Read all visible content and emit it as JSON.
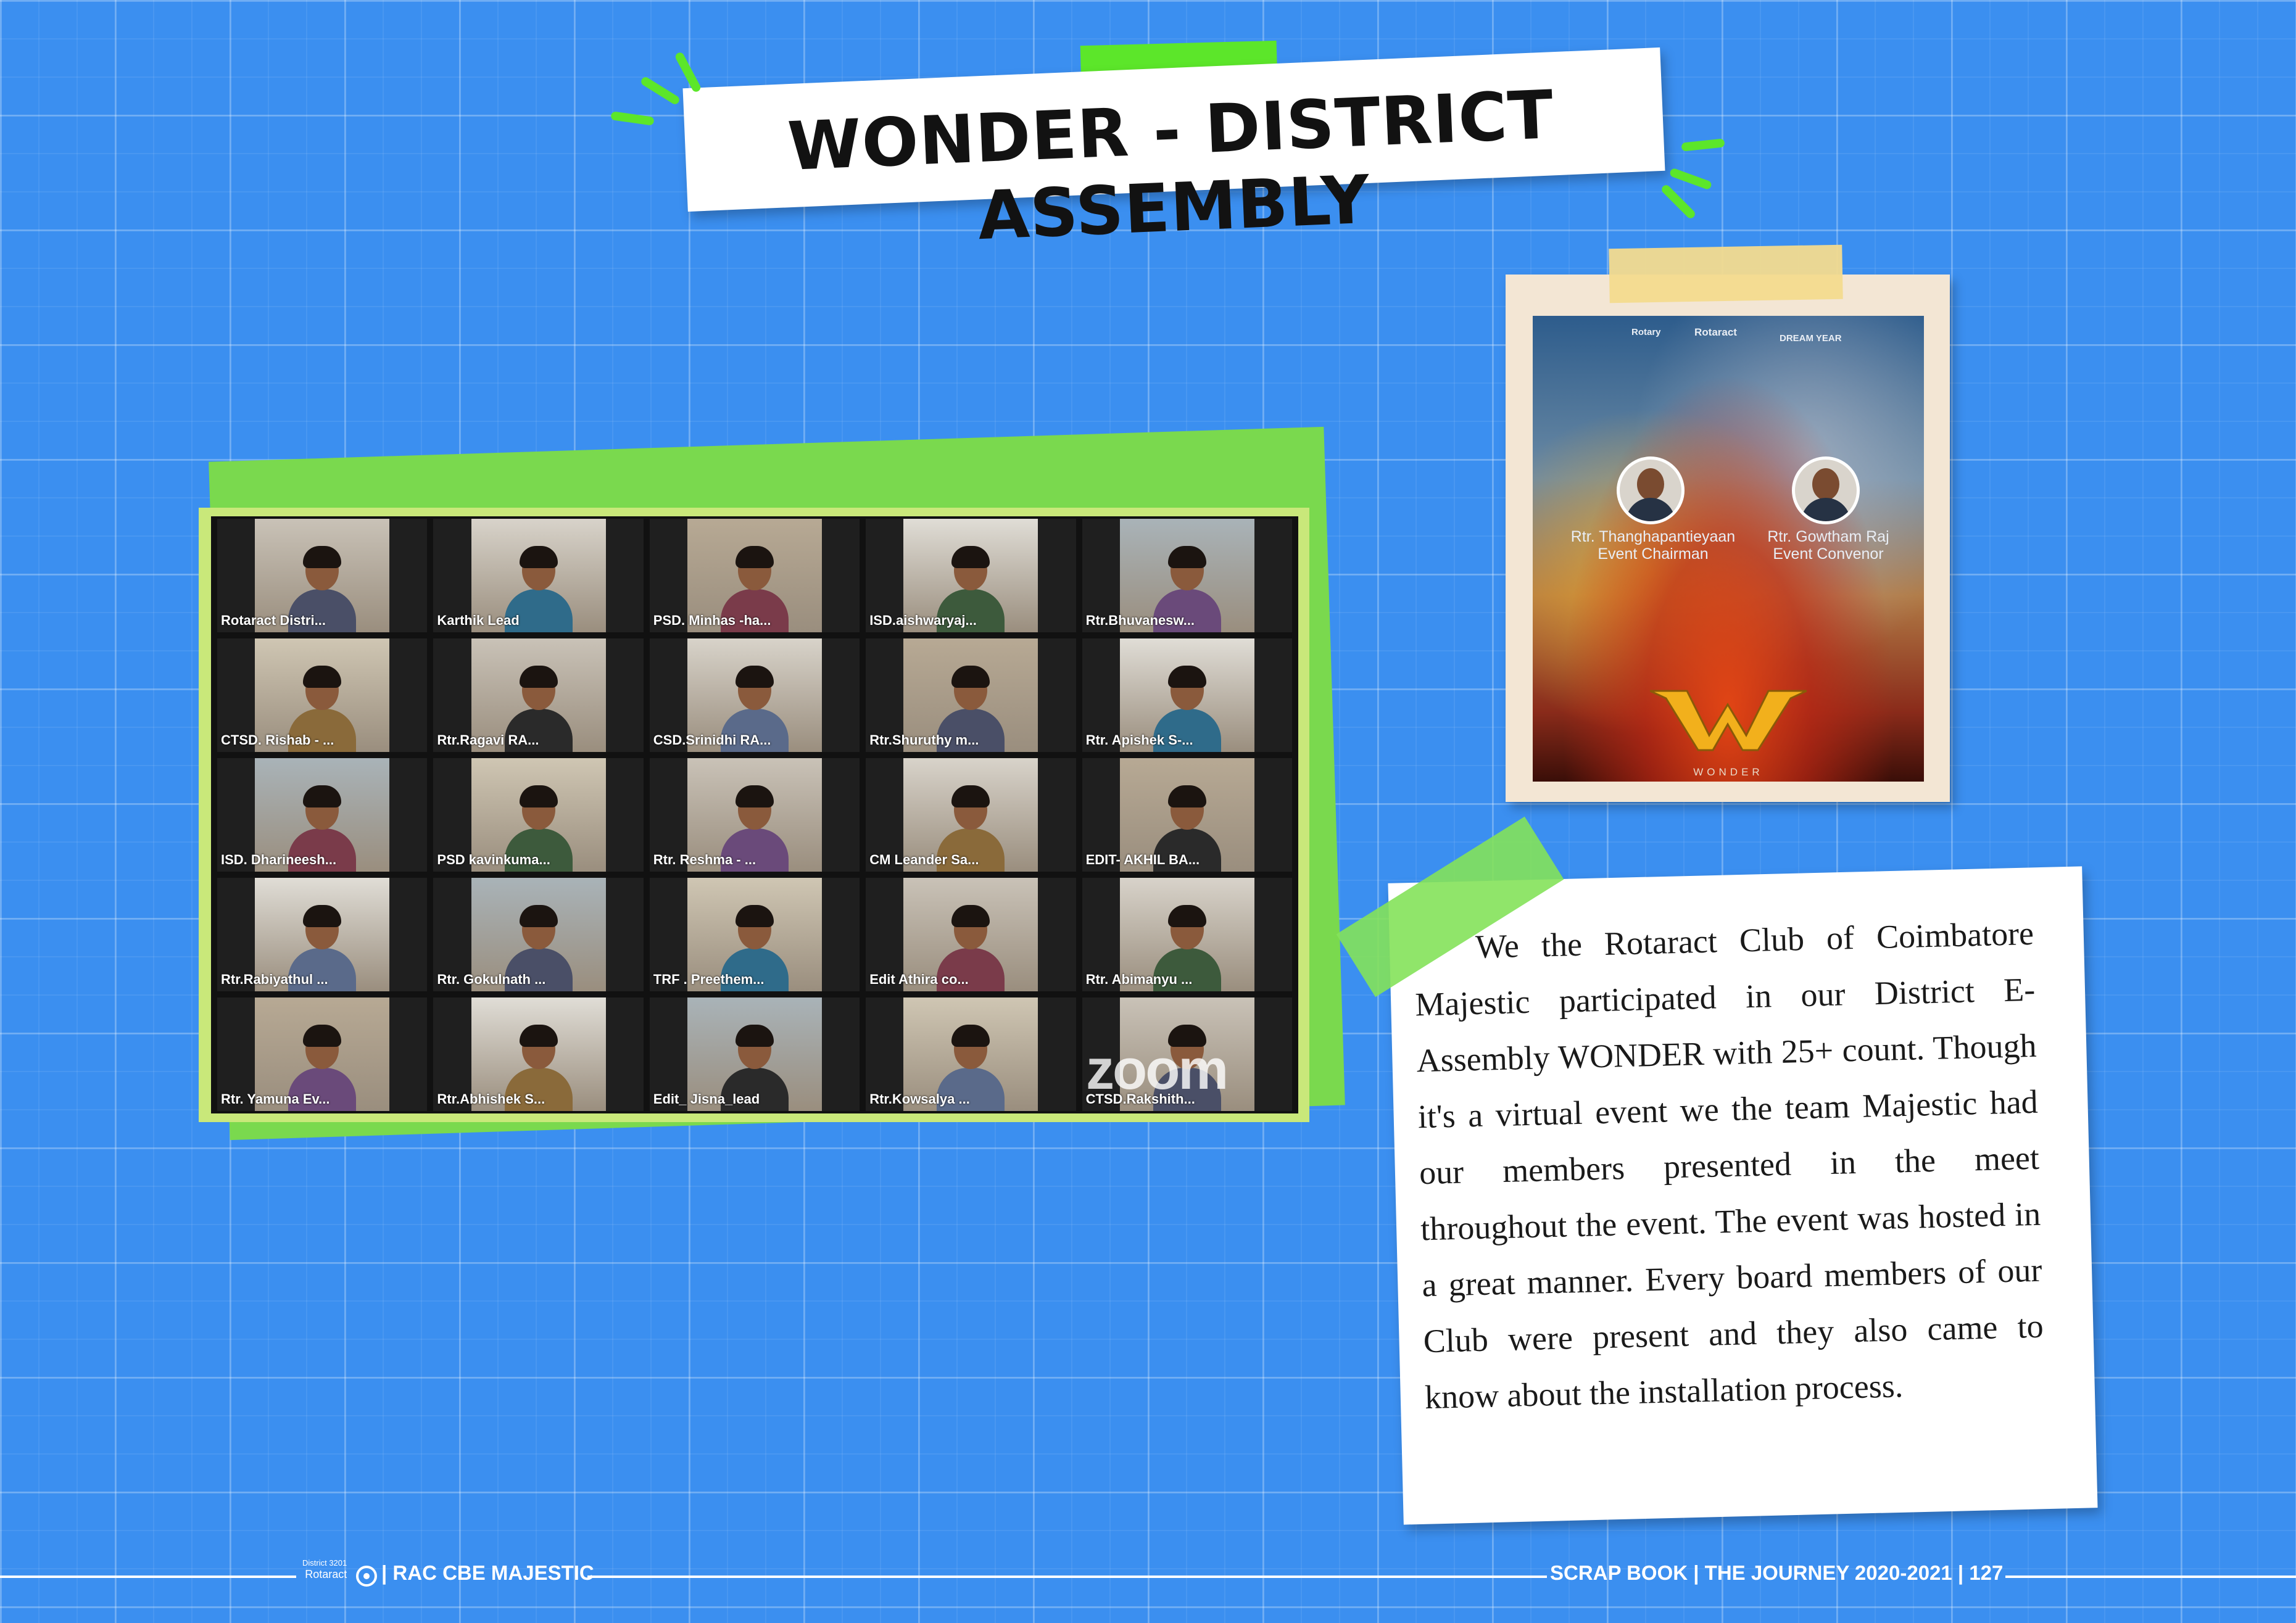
{
  "title": "WONDER - DISTRICT ASSEMBLY",
  "zoom": {
    "brand": "zoom",
    "participants": [
      "Rotaract Distri...",
      "Karthik Lead",
      "PSD. Minhas -ha...",
      "ISD.aishwaryaj...",
      "Rtr.Bhuvanesw...",
      "CTSD. Rishab - ...",
      "Rtr.Ragavi RA...",
      "CSD.Srinidhi RA...",
      "Rtr.Shuruthy m...",
      "Rtr. Apishek S-...",
      "ISD. Dharineesh...",
      "PSD kavinkuma...",
      "Rtr. Reshma - ...",
      "CM Leander Sa...",
      "EDIT- AKHIL BA...",
      "Rtr.Rabiyathul ...",
      "Rtr. Gokulnath ...",
      "TRF . Preethem...",
      "Edit Athira co...",
      "Rtr. Abimanyu ...",
      "Rtr. Yamuna Ev...",
      "Rtr.Abhishek S...",
      "Edit_ Jisna_lead",
      "Rtr.Kowsalya ...",
      "CTSD.Rakshith..."
    ]
  },
  "poster": {
    "logo_rotary": "Rotary",
    "logo_rotaract": "Rotaract",
    "logo_dream": "DREAM YEAR",
    "person1_name": "Rtr. Thanghapantieyaan",
    "person1_role": "Event Chairman",
    "person2_name": "Rtr. Gowtham Raj",
    "person2_role": "Event Convenor",
    "event": "WONDER"
  },
  "note": "We the Rotaract Club of Coimbatore Majestic participated in our District E-Assembly WONDER with 25+ count. Though it's a virtual event we the team Majestic had our members presented in the meet throughout the event. The event was hosted in a great manner. Every board members of our Club were present and they also came to know about the installation process.",
  "footer": {
    "logo_district": "District 3201",
    "logo_name": "Rotaract",
    "left": "| RAC CBE MAJESTIC",
    "right": "SCRAP BOOK | THE JOURNEY 2020-2021 | 127"
  },
  "colors": {
    "background": "#3b8ff0",
    "accent_green": "#5ce62a",
    "tape": "#f3db8e"
  }
}
